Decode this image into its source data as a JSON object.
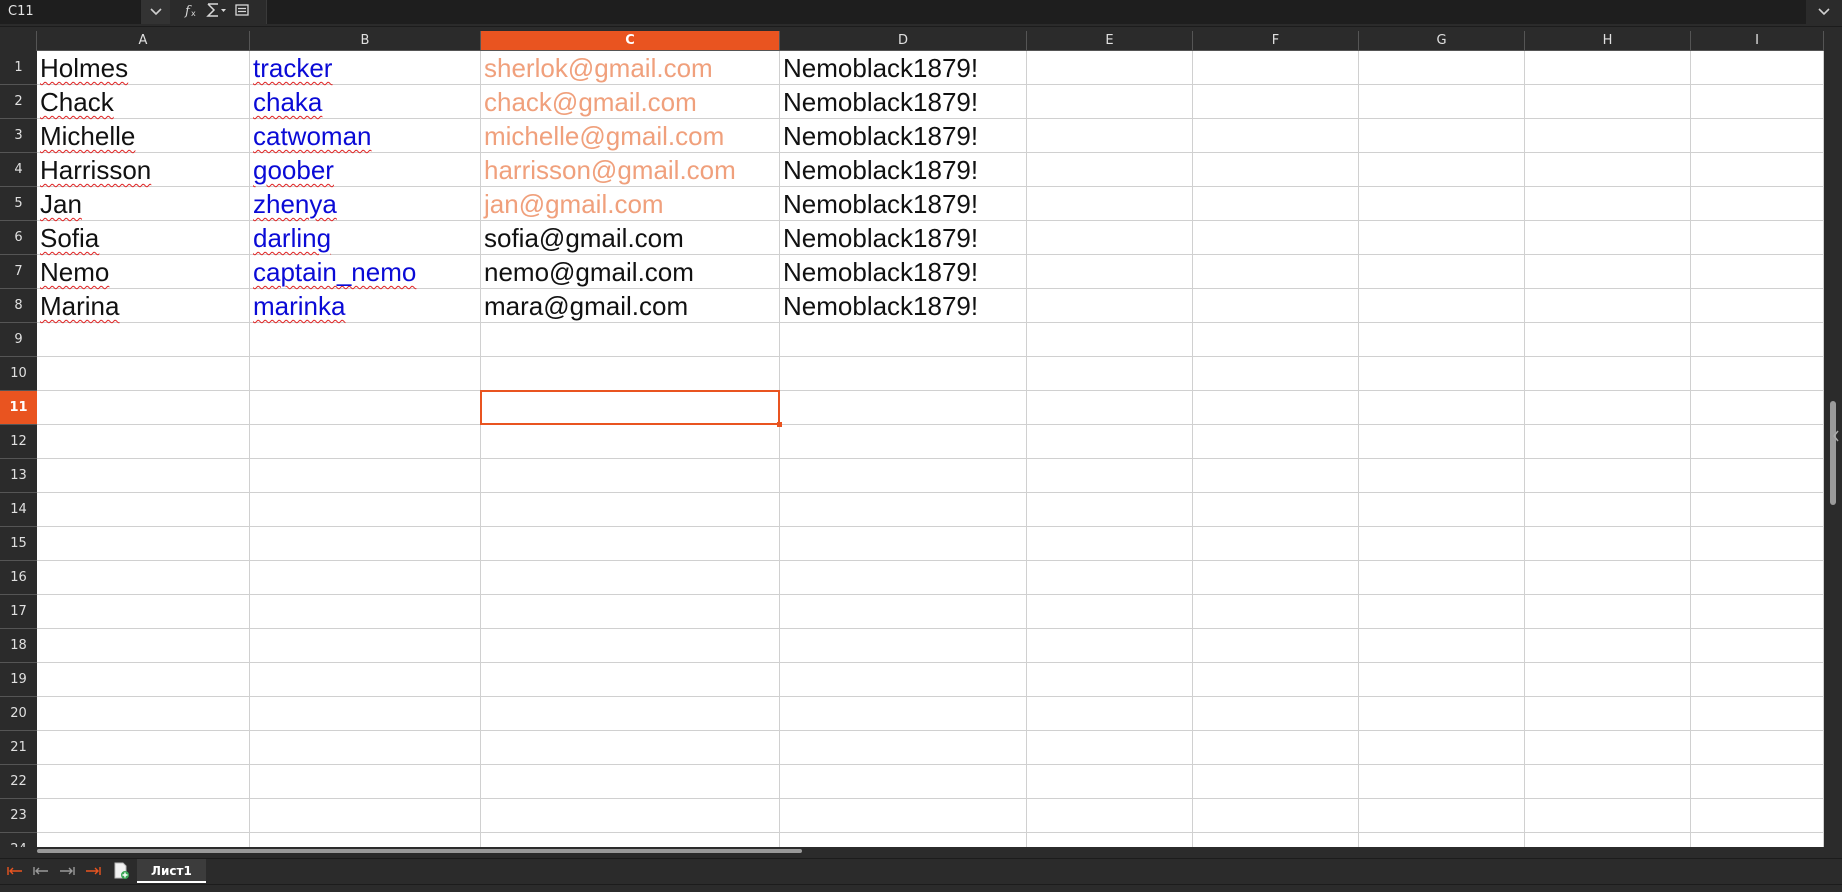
{
  "formula_bar": {
    "cell_ref": "C11",
    "formula": ""
  },
  "columns": [
    "A",
    "B",
    "C",
    "D",
    "E",
    "F",
    "G",
    "H",
    "I"
  ],
  "selected_column": "C",
  "rows": [
    "1",
    "2",
    "3",
    "4",
    "5",
    "6",
    "7",
    "8",
    "9",
    "10",
    "11",
    "12",
    "13",
    "14",
    "15",
    "16",
    "17",
    "18",
    "19",
    "20",
    "21",
    "22",
    "23",
    "24"
  ],
  "selected_row": "11",
  "cells": [
    {
      "name": "Holmes",
      "user": "tracker",
      "email": "sherlok@gmail.com",
      "password": "Nemoblack1879!"
    },
    {
      "name": "Chack",
      "user": "chaka",
      "email": "chack@gmail.com",
      "password": "Nemoblack1879!"
    },
    {
      "name": "Michelle",
      "user": "catwoman",
      "email": "michelle@gmail.com",
      "password": "Nemoblack1879!"
    },
    {
      "name": "Harrisson",
      "user": "goober",
      "email": "harrisson@gmail.com",
      "password": "Nemoblack1879!"
    },
    {
      "name": "Jan",
      "user": "zhenya",
      "email": "jan@gmail.com",
      "password": "Nemoblack1879!"
    },
    {
      "name": "Sofia",
      "user": "darling",
      "email": "sofia@gmail.com",
      "password": "Nemoblack1879!"
    },
    {
      "name": "Nemo",
      "user": "captain_nemo",
      "email": "nemo@gmail.com",
      "password": "Nemoblack1879!"
    },
    {
      "name": "Marina",
      "user": "marinka",
      "email": "mara@gmail.com",
      "password": "Nemoblack1879!"
    }
  ],
  "faded_email_rows": 5,
  "sheet_tabs": [
    {
      "label": "Лист1",
      "active": true
    }
  ],
  "icons": {
    "name_box_dropdown": "chevron-down-icon",
    "function_wizard": "function-wizard-icon",
    "sum": "sum-icon",
    "formula": "formula-icon",
    "expand": "chevron-down-icon",
    "first_sheet": "first-sheet-icon",
    "prev_sheet": "prev-sheet-icon",
    "next_sheet": "next-sheet-icon",
    "last_sheet": "last-sheet-icon",
    "add_sheet": "add-sheet-icon"
  },
  "colors": {
    "accent": "#e95420",
    "link_text": "#0a0ad6",
    "faded_email": "#f0a07c",
    "chrome_bg": "#2b2b2b"
  }
}
